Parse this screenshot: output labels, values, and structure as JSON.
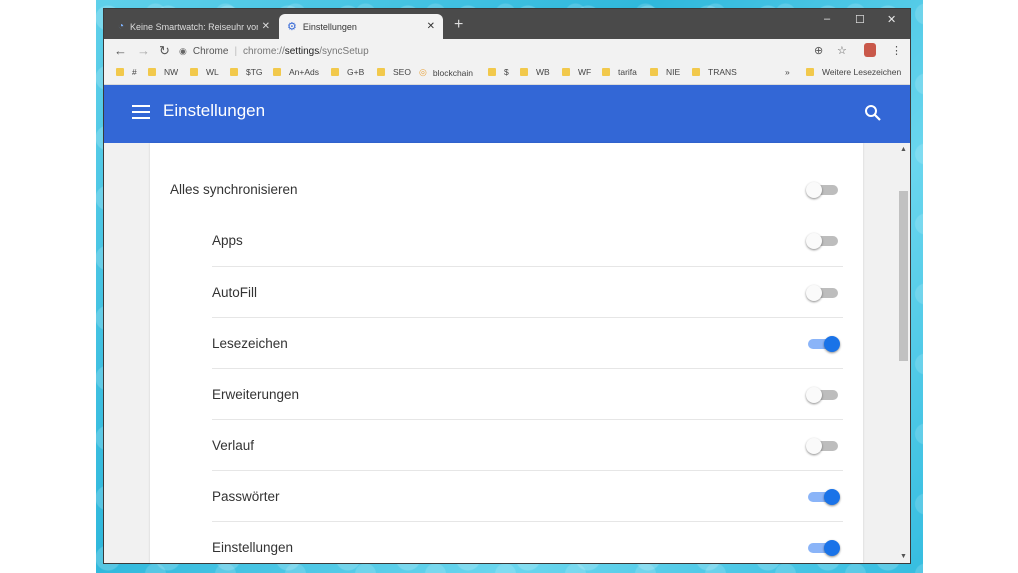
{
  "browser": {
    "tabs": [
      {
        "title": "Keine Smartwatch: Reiseuhr von ...",
        "active": false
      },
      {
        "title": "Einstellungen",
        "active": true
      }
    ],
    "new_tab": "+",
    "window_controls": [
      "–",
      "☐",
      "✕"
    ],
    "omnibox": {
      "site_label": "Chrome",
      "url_scheme": "chrome://",
      "url_host": "settings",
      "url_path": "/syncSetup"
    },
    "bookmarks": [
      "#",
      "NW",
      "WL",
      "$TG",
      "An+Ads",
      "G+B",
      "SEO",
      "blockchain",
      "$",
      "WB",
      "WF",
      "tarifa",
      "NIE",
      "TRANS"
    ],
    "bookmarks_overflow": "»",
    "other_bookmarks": "Weitere Lesezeichen"
  },
  "settings": {
    "title": "Einstellungen",
    "sync_all": {
      "label": "Alles synchronisieren",
      "enabled": false
    },
    "items": [
      {
        "label": "Apps",
        "enabled": false
      },
      {
        "label": "AutoFill",
        "enabled": false
      },
      {
        "label": "Lesezeichen",
        "enabled": true
      },
      {
        "label": "Erweiterungen",
        "enabled": false
      },
      {
        "label": "Verlauf",
        "enabled": false
      },
      {
        "label": "Passwörter",
        "enabled": true
      },
      {
        "label": "Einstellungen",
        "enabled": true
      }
    ]
  },
  "colors": {
    "header": "#3367d6",
    "toggle_on": "#1a73e8",
    "toggle_off": "#bdbdbd"
  }
}
